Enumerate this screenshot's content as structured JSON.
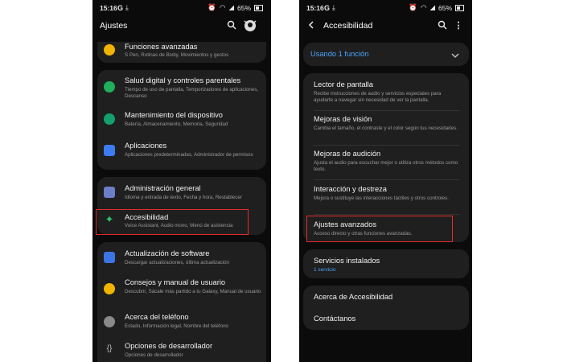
{
  "colors": {
    "accent_blue": "#4aa3ff",
    "highlight_red": "#e52b2b",
    "card_bg": "#1f1f1f"
  },
  "left": {
    "status": {
      "time": "15:16",
      "battery": "65%"
    },
    "header": {
      "title": "Ajustes"
    },
    "items": [
      {
        "title": "Funciones avanzadas",
        "subtitle": "S Pen, Rutinas de Bixby, Movimientos y gestos",
        "icon": "gear-star-icon"
      },
      {
        "title": "Salud digital y controles parentales",
        "subtitle": "Tiempo de uso de pantalla, Temporizadores de aplicaciones, Descanso",
        "icon": "digital-wellbeing-icon"
      },
      {
        "title": "Mantenimiento del dispositivo",
        "subtitle": "Batería, Almacenamiento, Memoria, Seguridad",
        "icon": "device-care-icon"
      },
      {
        "title": "Aplicaciones",
        "subtitle": "Aplicaciones predeterminadas, Administrador de permisos",
        "icon": "apps-icon"
      },
      {
        "title": "Administración general",
        "subtitle": "Idioma y entrada de texto, Fecha y hora, Restablecer",
        "icon": "sliders-icon"
      },
      {
        "title": "Accesibilidad",
        "subtitle": "Voice Assistant, Audio mono, Menú de asistencia",
        "icon": "accessibility-icon"
      },
      {
        "title": "Actualización de software",
        "subtitle": "Descargar actualizaciones, última actualización",
        "icon": "software-update-icon"
      },
      {
        "title": "Consejos y manual de usuario",
        "subtitle": "Descubrir, Sácale más partido a tu Galaxy, Manual de usuario",
        "icon": "lightbulb-icon"
      },
      {
        "title": "Acerca del teléfono",
        "subtitle": "Estado, Información legal, Nombre del teléfono",
        "icon": "info-icon"
      },
      {
        "title": "Opciones de desarrollador",
        "subtitle": "Opciones de desarrollador",
        "icon": "developer-braces-icon"
      }
    ]
  },
  "right": {
    "status": {
      "time": "15:16",
      "battery": "65%"
    },
    "header": {
      "title": "Accesibilidad"
    },
    "summary": "Usando 1 función",
    "items": [
      {
        "title": "Lector de pantalla",
        "subtitle": "Recibe instrucciones de audio y servicios especiales para ayudarte a navegar sin necesidad de ver la pantalla."
      },
      {
        "title": "Mejoras de visión",
        "subtitle": "Cambia el tamaño, el contraste y el color según tus necesidades."
      },
      {
        "title": "Mejoras de audición",
        "subtitle": "Ajusta el audio para escuchar mejor o utiliza otros métodos como texto."
      },
      {
        "title": "Interacción y destreza",
        "subtitle": "Mejora o sustituye las interacciones táctiles y otros controles."
      },
      {
        "title": "Ajustes avanzados",
        "subtitle": "Acceso directo y otras funciones avanzadas."
      }
    ],
    "installed": {
      "title": "Servicios instalados",
      "subtitle": "1 servicio"
    },
    "about": "Acerca de Accesibilidad",
    "contact": "Contáctanos"
  }
}
